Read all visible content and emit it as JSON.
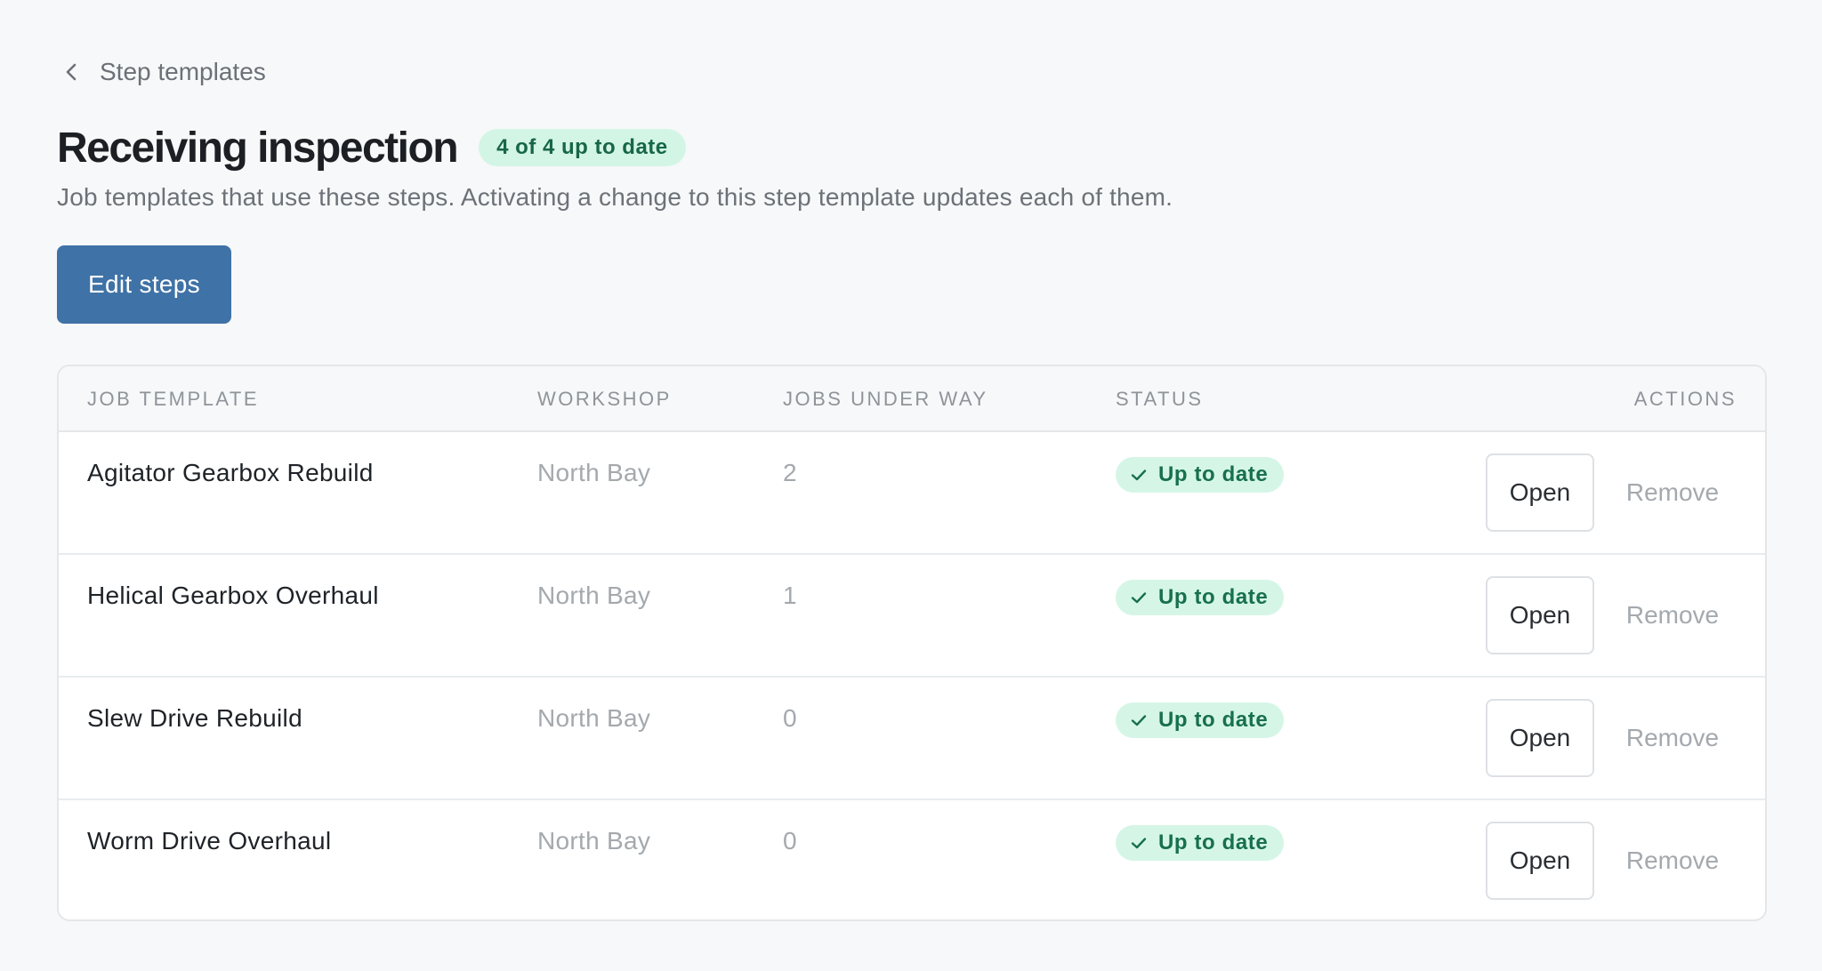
{
  "breadcrumb": {
    "back_label": "Step templates",
    "icon": "chevron-left-icon"
  },
  "header": {
    "title": "Receiving inspection",
    "count_badge": "4 of 4 up to date",
    "subtitle": "Job templates that use these steps. Activating a change to this step template updates each of them."
  },
  "actions": {
    "edit_label": "Edit steps"
  },
  "table": {
    "columns": {
      "job_template": "JOB TEMPLATE",
      "workshop": "WORKSHOP",
      "jobs_under_way": "JOBS UNDER WAY",
      "status": "STATUS",
      "actions": "ACTIONS"
    },
    "rows": [
      {
        "name": "Agitator Gearbox Rebuild",
        "workshop": "North Bay",
        "jobs": "2",
        "status": "Up to date",
        "open": "Open",
        "remove": "Remove"
      },
      {
        "name": "Helical Gearbox Overhaul",
        "workshop": "North Bay",
        "jobs": "1",
        "status": "Up to date",
        "open": "Open",
        "remove": "Remove"
      },
      {
        "name": "Slew Drive Rebuild",
        "workshop": "North Bay",
        "jobs": "0",
        "status": "Up to date",
        "open": "Open",
        "remove": "Remove"
      },
      {
        "name": "Worm Drive Overhaul",
        "workshop": "North Bay",
        "jobs": "0",
        "status": "Up to date",
        "open": "Open",
        "remove": "Remove"
      }
    ]
  },
  "colors": {
    "primary": "#3f72a6",
    "success_bg": "#d5f6e7",
    "success_text": "#18704c",
    "muted_text": "#a4a9ae",
    "background": "#f7f8f9"
  }
}
